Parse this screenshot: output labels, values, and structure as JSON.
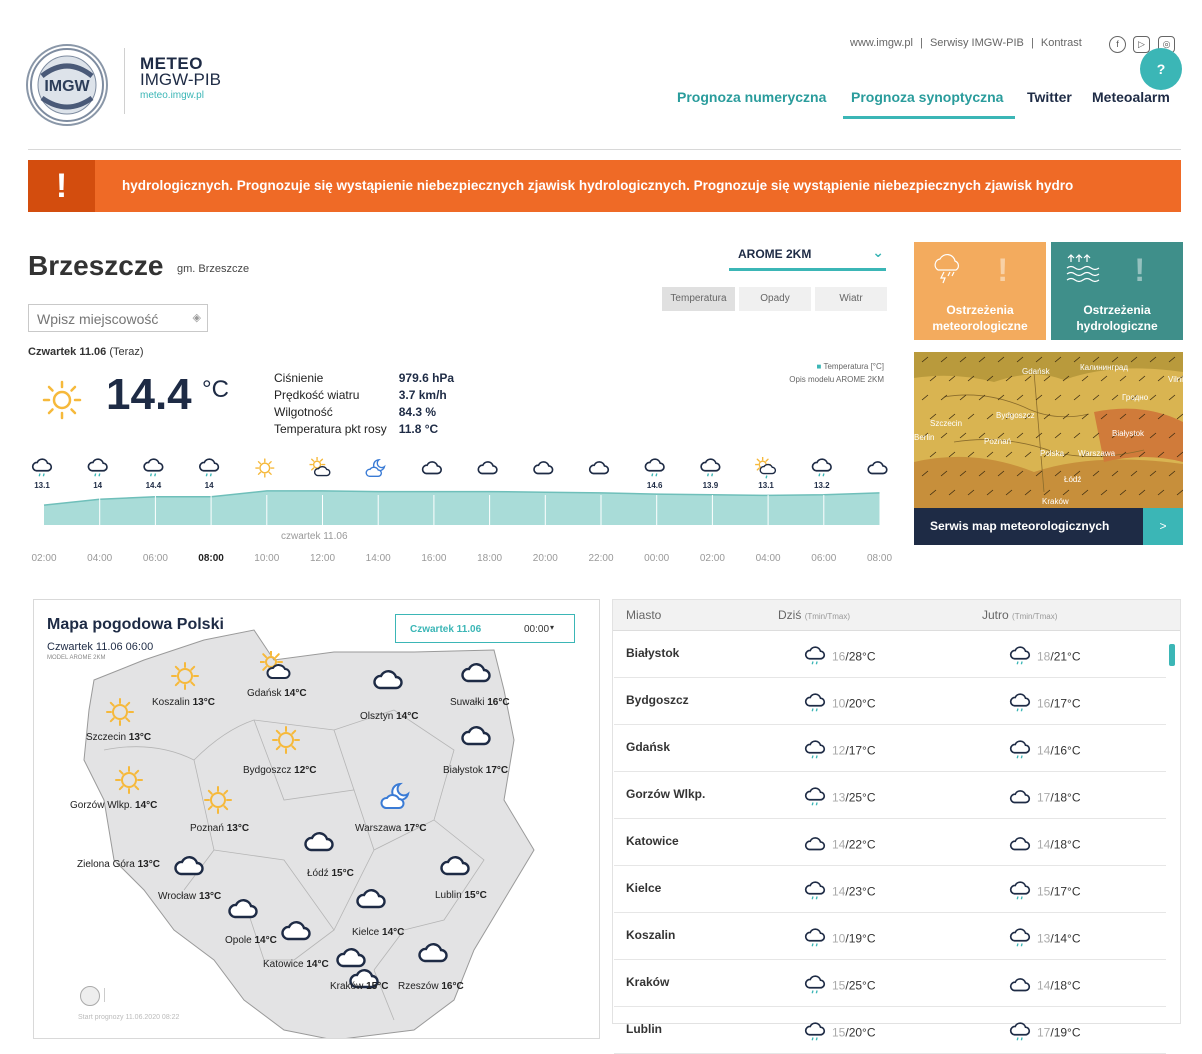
{
  "brand": {
    "line1": "METEO",
    "line2": "IMGW-PIB",
    "url": "meteo.imgw.pl",
    "logo_text": "IMGW"
  },
  "toplinks": [
    "www.imgw.pl",
    "|",
    "Serwisy IMGW-PIB",
    "|",
    "Kontrast"
  ],
  "social": [
    "facebook-icon",
    "youtube-icon",
    "instagram-icon"
  ],
  "help": "?",
  "nav": {
    "numeric": "Prognoza numeryczna",
    "synoptic": "Prognoza synoptyczna",
    "twitter": "Twitter",
    "meteoalarm": "Meteoalarm"
  },
  "alert": {
    "icon": "!",
    "text": "hydrologicznych. Prognozuje się wystąpienie niebezpiecznych zjawisk hydrologicznych.   Prognozuje się wystąpienie niebezpiecznych zjawisk hydro"
  },
  "location": {
    "city": "Brzeszcze",
    "gmina": "gm. Brzeszcze"
  },
  "search": {
    "placeholder": "Wpisz miejscowość"
  },
  "current": {
    "day": "Czwartek 11.06",
    "now": "(Teraz)",
    "temp": "14.4",
    "unit": "°C",
    "details": [
      {
        "label": "Ciśnienie",
        "value": "979.6 hPa"
      },
      {
        "label": "Prędkość wiatru",
        "value": "3.7 km/h"
      },
      {
        "label": "Wilgotność",
        "value": "84.3 %"
      },
      {
        "label": "Temperatura pkt rosy",
        "value": "11.8 °C"
      }
    ]
  },
  "model": {
    "name": "AROME 2KM"
  },
  "tabs": [
    "Temperatura",
    "Opady",
    "Wiatr"
  ],
  "chart_legend": {
    "series": "Temperatura [°C]",
    "desc": "Opis modelu AROME 2KM"
  },
  "chart_data": {
    "type": "area",
    "x": [
      "02:00",
      "04:00",
      "06:00",
      "08:00",
      "10:00",
      "12:00",
      "14:00",
      "16:00",
      "18:00",
      "20:00",
      "22:00",
      "00:00",
      "02:00",
      "04:00",
      "06:00",
      "08:00"
    ],
    "values": [
      13.1,
      14,
      14.4,
      14.4,
      15.3,
      15.3,
      15.2,
      15.2,
      15.2,
      15.1,
      15.0,
      14.8,
      14.7,
      14.6,
      14.7,
      15.0
    ],
    "temp_labels": [
      "13.1",
      "14",
      "14.4",
      "14",
      "",
      "",
      "",
      "",
      "",
      "",
      "",
      "14.6",
      "13.9",
      "13.1",
      "13.2",
      ""
    ],
    "day_label": "czwartek 11.06",
    "current_tick": "08:00",
    "ylim": [
      10,
      17
    ],
    "icons": [
      "rain-cloud-icon",
      "rain-cloud-icon",
      "rain-cloud-icon",
      "rain-cloud-icon",
      "sun-icon",
      "sun-cloud-icon",
      "cloud-moon-icon",
      "cloud-icon",
      "cloud-icon",
      "cloud-icon",
      "cloud-icon",
      "rain-cloud-icon",
      "rain-cloud-icon",
      "sun-rain-icon",
      "rain-cloud-icon",
      "cloud-icon"
    ]
  },
  "tiles": {
    "meteo": "Ostrzeżenia meteorologiczne",
    "hydro": "Ostrzeżenia hydrologiczne",
    "map_link": "Serwis map meteorologicznych",
    "map_arrow": ">",
    "map_places": [
      "Gdańsk",
      "Калининград",
      "Vilni",
      "Гродно",
      "Bydgoszcz",
      "Szczecin",
      "Berlin",
      "Białystok",
      "Poznań",
      "Polska",
      "Warszawa",
      "Łódź",
      "Kraków"
    ]
  },
  "poland_map": {
    "title": "Mapa pogodowa Polski",
    "date": "Czwartek 11.06 06:00",
    "model": "MODEL AROME 2KM",
    "select_day": "Czwartek 11.06",
    "select_hour": "00:00",
    "footer": "Start prognozy 11.06.2020 08:22",
    "cities": [
      {
        "name": "Koszalin",
        "temp": "13°C",
        "icon": "sun-icon"
      },
      {
        "name": "Gdańsk",
        "temp": "14°C",
        "icon": "sun-cloud-icon"
      },
      {
        "name": "Olsztyn",
        "temp": "14°C",
        "icon": "cloud-icon"
      },
      {
        "name": "Suwałki",
        "temp": "16°C",
        "icon": "cloud-icon"
      },
      {
        "name": "Szczecin",
        "temp": "13°C",
        "icon": "sun-icon"
      },
      {
        "name": "Bydgoszcz",
        "temp": "12°C",
        "icon": "sun-icon"
      },
      {
        "name": "Białystok",
        "temp": "17°C",
        "icon": "cloud-icon"
      },
      {
        "name": "Gorzów Wlkp.",
        "temp": "14°C",
        "icon": "sun-icon"
      },
      {
        "name": "Poznań",
        "temp": "13°C",
        "icon": "sun-icon"
      },
      {
        "name": "Warszawa",
        "temp": "17°C",
        "icon": "cloud-moon-icon"
      },
      {
        "name": "Zielona Góra",
        "temp": "13°C",
        "icon": "cloud-icon"
      },
      {
        "name": "Łódź",
        "temp": "15°C",
        "icon": "cloud-icon"
      },
      {
        "name": "Lublin",
        "temp": "15°C",
        "icon": "cloud-icon"
      },
      {
        "name": "Wrocław",
        "temp": "13°C",
        "icon": "cloud-icon"
      },
      {
        "name": "Kielce",
        "temp": "14°C",
        "icon": "cloud-icon"
      },
      {
        "name": "Opole",
        "temp": "14°C",
        "icon": "cloud-icon"
      },
      {
        "name": "Katowice",
        "temp": "14°C",
        "icon": "cloud-icon"
      },
      {
        "name": "Kraków",
        "temp": "15°C",
        "icon": "cloud-icon"
      },
      {
        "name": "Rzeszów",
        "temp": "16°C",
        "icon": "cloud-icon"
      }
    ]
  },
  "table": {
    "col_city": "Miasto",
    "col_today": "Dziś",
    "col_tomorrow": "Jutro",
    "range_hint": "(Tmin/Tmax)",
    "rows": [
      {
        "city": "Białystok",
        "today_min": "16",
        "today_max": "/28°C",
        "tom_min": "18",
        "tom_max": "/21°C",
        "icon1": "rain-cloud-icon",
        "icon2": "rain-cloud-icon"
      },
      {
        "city": "Bydgoszcz",
        "today_min": "10",
        "today_max": "/20°C",
        "tom_min": "16",
        "tom_max": "/17°C",
        "icon1": "rain-cloud-icon",
        "icon2": "rain-cloud-icon"
      },
      {
        "city": "Gdańsk",
        "today_min": "12",
        "today_max": "/17°C",
        "tom_min": "14",
        "tom_max": "/16°C",
        "icon1": "rain-cloud-icon",
        "icon2": "rain-cloud-icon"
      },
      {
        "city": "Gorzów Wlkp.",
        "today_min": "13",
        "today_max": "/25°C",
        "tom_min": "17",
        "tom_max": "/18°C",
        "icon1": "rain-cloud-icon",
        "icon2": "cloud-icon"
      },
      {
        "city": "Katowice",
        "today_min": "14",
        "today_max": "/22°C",
        "tom_min": "14",
        "tom_max": "/18°C",
        "icon1": "cloud-icon",
        "icon2": "cloud-icon"
      },
      {
        "city": "Kielce",
        "today_min": "14",
        "today_max": "/23°C",
        "tom_min": "15",
        "tom_max": "/17°C",
        "icon1": "rain-cloud-icon",
        "icon2": "rain-cloud-icon"
      },
      {
        "city": "Koszalin",
        "today_min": "10",
        "today_max": "/19°C",
        "tom_min": "13",
        "tom_max": "/14°C",
        "icon1": "rain-cloud-icon",
        "icon2": "rain-cloud-icon"
      },
      {
        "city": "Kraków",
        "today_min": "15",
        "today_max": "/25°C",
        "tom_min": "14",
        "tom_max": "/18°C",
        "icon1": "rain-cloud-icon",
        "icon2": "cloud-icon"
      },
      {
        "city": "Lublin",
        "today_min": "15",
        "today_max": "/20°C",
        "tom_min": "17",
        "tom_max": "/19°C",
        "icon1": "rain-cloud-icon",
        "icon2": "rain-cloud-icon"
      }
    ]
  },
  "colors": {
    "teal": "#3bb6b6",
    "navy": "#1e2b45",
    "orange": "#ef6a26",
    "chart_fill": "#a9dcd8",
    "sun": "#f6b93b"
  }
}
